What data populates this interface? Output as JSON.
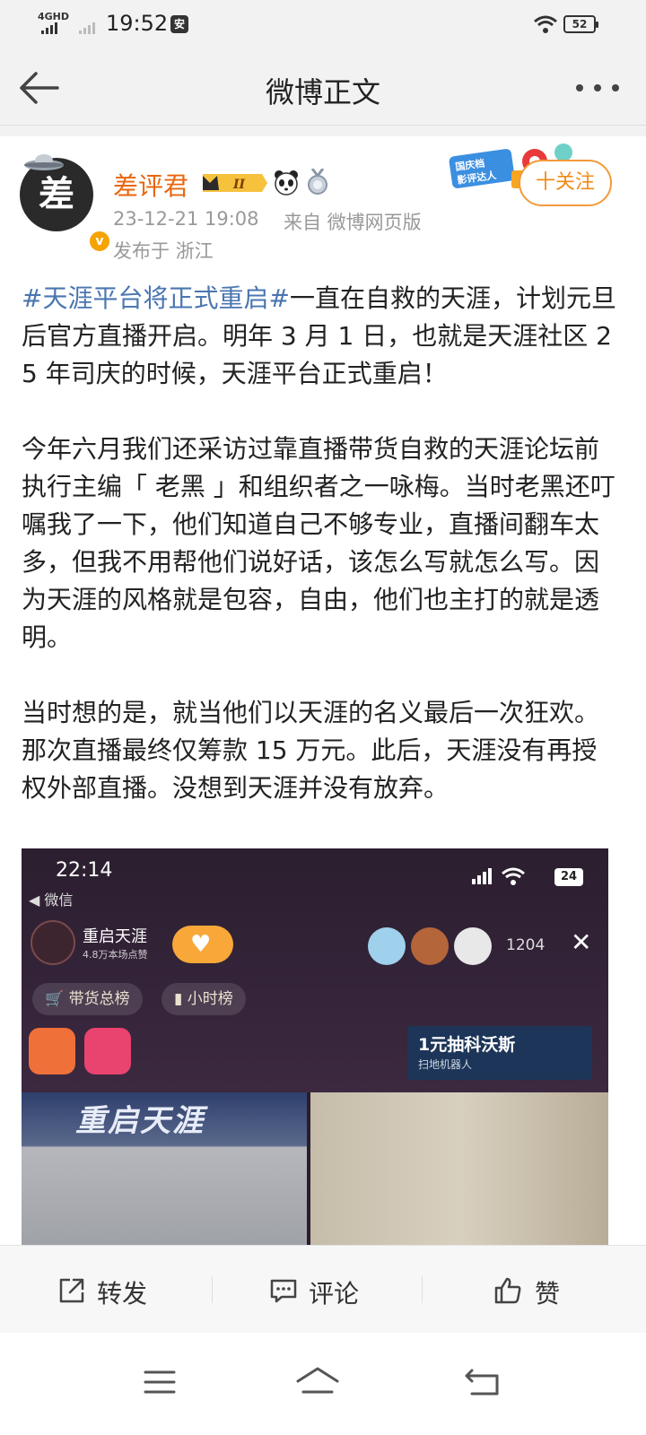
{
  "status_bar": {
    "network": "4GHD",
    "time": "19:52",
    "app_badge": "安",
    "battery": "52"
  },
  "header": {
    "title": "微博正文"
  },
  "post": {
    "avatar_char": "差",
    "author": "差评君",
    "level_badge": "II",
    "verified_mark": "v",
    "timestamp": "23-12-21 19:08",
    "source": "来自 微博网页版",
    "location": "发布于 浙江",
    "event_badge_text": "国庆档影评达人",
    "follow_label": "十关注",
    "paragraphs": [
      {
        "hashtag": "#天涯平台将正式重启#",
        "text": "一直在自救的天涯，计划元旦后官方直播开启。明年 3 月 1 日，也就是天涯社区 25 年司庆的时候，天涯平台正式重启！"
      },
      {
        "hashtag": "",
        "text": "今年六月我们还采访过靠直播带货自救的天涯论坛前执行主编「 老黑 」和组织者之一咏梅。当时老黑还叮嘱我了一下，他们知道自己不够专业，直播间翻车太多，但我不用帮他们说好话，该怎么写就怎么写。因为天涯的风格就是包容，自由，他们也主打的就是透明。"
      },
      {
        "hashtag": "",
        "text": "当时想的是，就当他们以天涯的名义最后一次狂欢。那次直播最终仅筹款 15 万元。此后，天涯没有再授权外部直播。没想到天涯并没有放弃。"
      }
    ]
  },
  "embedded_image": {
    "time": "22:14",
    "back_label": "◀ 微信",
    "battery": "24",
    "room_title": "重启天涯",
    "room_subtitle": "4.8万本场点赞",
    "viewer_count": "1204",
    "close_glyph": "✕",
    "chip_sales": "带货总榜",
    "chip_hourly": "小时榜",
    "promo_title": "1元抽科沃斯",
    "promo_subtitle": "扫地机器人",
    "banner_text": "重启天涯"
  },
  "actions": {
    "repost": "转发",
    "comment": "评论",
    "like": "赞"
  },
  "colors": {
    "accent_orange": "#e8660f",
    "hashtag_blue": "#4a76b0",
    "meta_gray": "#999999"
  }
}
